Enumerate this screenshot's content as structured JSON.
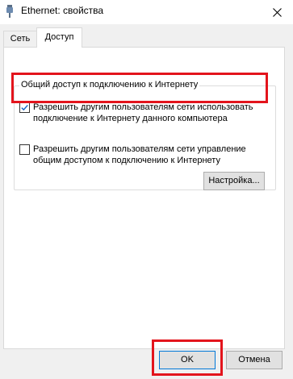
{
  "window": {
    "title": "Ethernet: свойства"
  },
  "tabs": [
    {
      "label": "Сеть",
      "active": false
    },
    {
      "label": "Доступ",
      "active": true
    }
  ],
  "sharing_group": {
    "legend": "Общий доступ к подключению к Интернету",
    "allow_share": {
      "label": "Разрешить другим пользователям сети использовать подключение к Интернету данного компьютера",
      "checked": true
    },
    "allow_control": {
      "label": "Разрешить другим пользователям сети управление общим доступом к подключению к Интернету",
      "checked": false
    },
    "settings_button": "Настройка..."
  },
  "footer": {
    "ok_label": "OK",
    "cancel_label": "Отмена"
  },
  "colors": {
    "highlight": "#e3141c",
    "check": "#0f62c4"
  }
}
